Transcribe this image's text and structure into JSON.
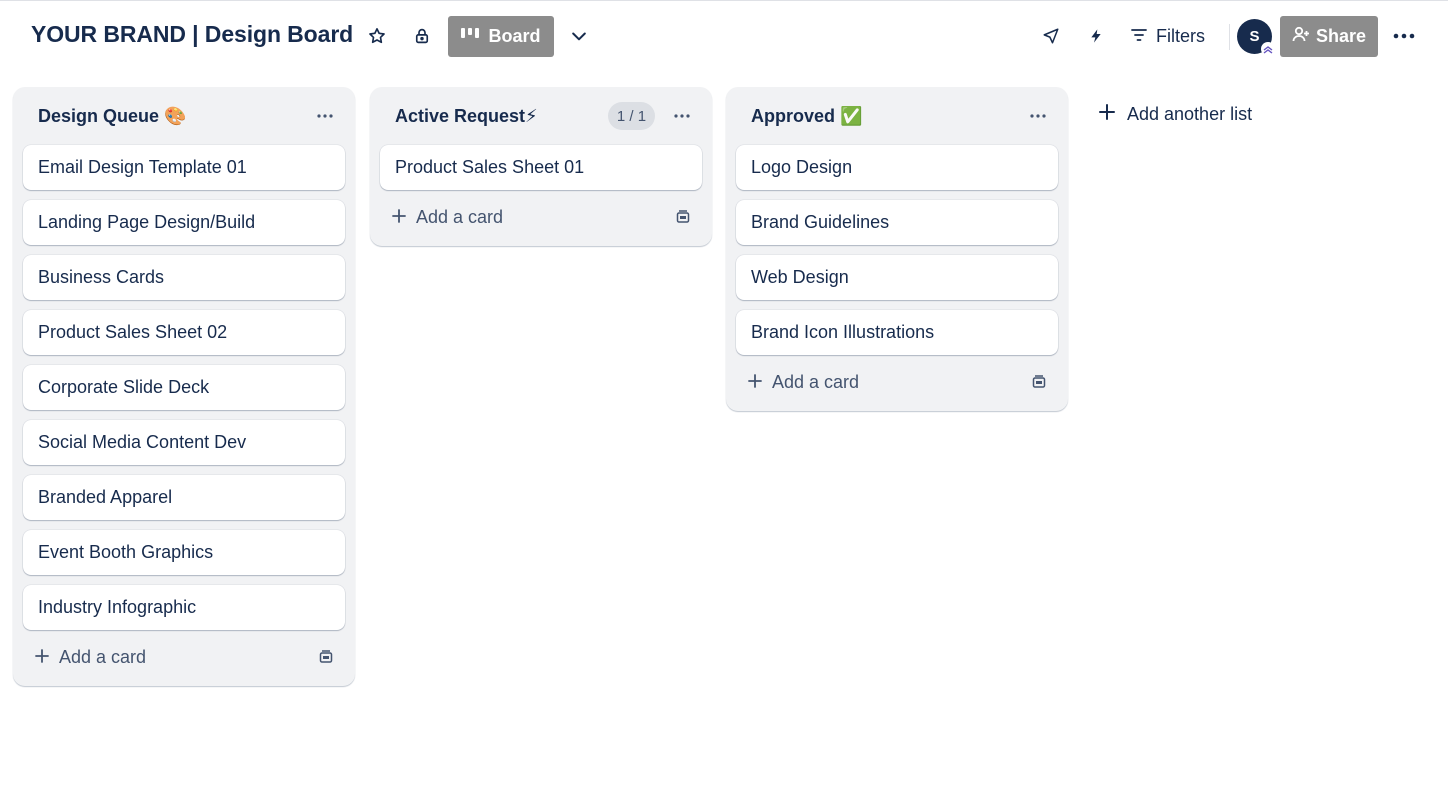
{
  "header": {
    "board_title": "YOUR BRAND | Design Board",
    "star_icon": "star-icon",
    "visibility_icon": "lock-icon",
    "view_button_label": "Board",
    "view_icon": "board-columns-icon",
    "view_switch_icon": "chevron-down-icon",
    "power_ups_icon": "rocket-icon",
    "automation_icon": "bolt-icon",
    "filters_label": "Filters",
    "avatar_initial": "S",
    "share_label": "Share",
    "more_icon": "ellipsis-icon"
  },
  "lists": [
    {
      "title": "Design Queue 🎨",
      "count": "",
      "cards": [
        "Email Design Template 01",
        "Landing Page Design/Build",
        "Business Cards",
        "Product Sales Sheet 02",
        "Corporate Slide Deck",
        "Social Media Content Dev",
        "Branded Apparel",
        "Event Booth Graphics",
        "Industry Infographic"
      ],
      "add_card_label": "Add a card"
    },
    {
      "title": "Active Request⚡",
      "count": "1 / 1",
      "cards": [
        "Product Sales Sheet 01"
      ],
      "add_card_label": "Add a card"
    },
    {
      "title": "Approved ✅",
      "count": "",
      "cards": [
        "Logo Design",
        "Brand Guidelines",
        "Web Design",
        "Brand Icon Illustrations"
      ],
      "add_card_label": "Add a card"
    }
  ],
  "add_list_label": "Add another list",
  "colors": {
    "text": "#172b4d",
    "list_bg": "#f1f2f4",
    "button_gray": "#8c8c8c",
    "avatar_bg": "#172b4d"
  }
}
